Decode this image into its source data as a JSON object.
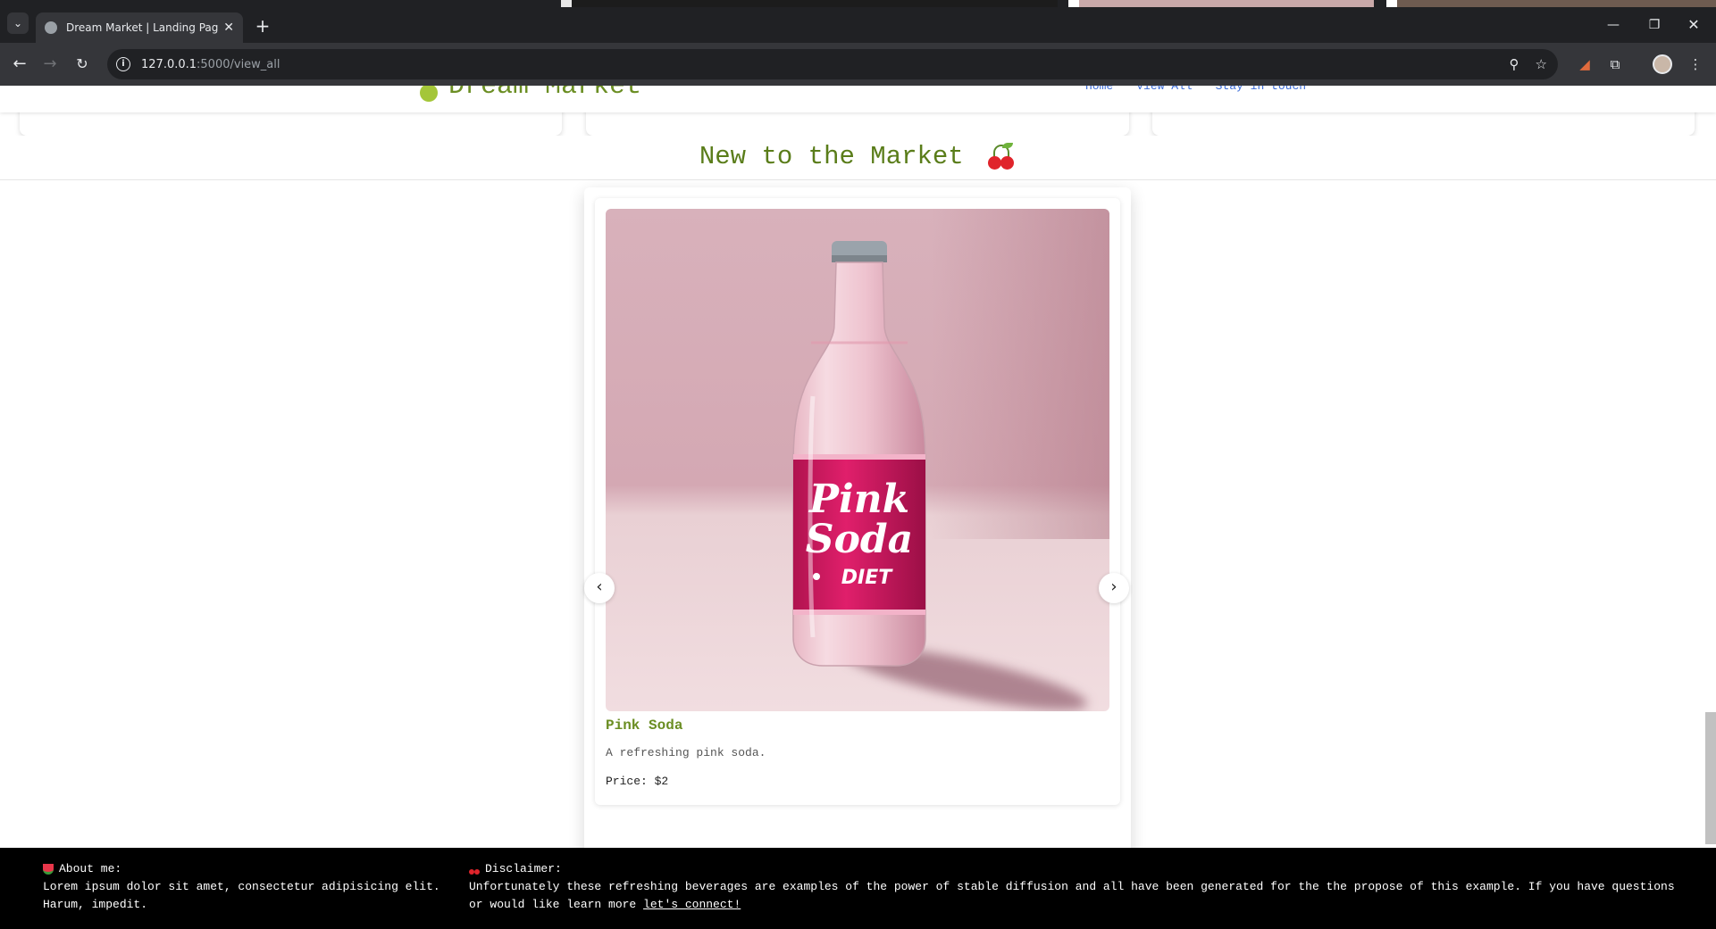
{
  "browser": {
    "tab_title": "Dream Market | Landing Page",
    "url_host": "127.0.0.1",
    "url_path": ":5000/view_all"
  },
  "header": {
    "brand": "Dream Market",
    "nav": [
      "Home",
      "View All",
      "Stay in touch"
    ]
  },
  "section": {
    "title": "New to the Market"
  },
  "carousel": {
    "product": {
      "name": "Pink Soda",
      "description": "A refreshing pink soda.",
      "price": "Price: $2",
      "label_line1": "Pink",
      "label_line2": "Soda",
      "label_line3": "DIET"
    }
  },
  "footer": {
    "about_heading": "About me:",
    "about_text": "Lorem ipsum dolor sit amet, consectetur adipisicing elit. Harum, impedit.",
    "disclaimer_heading": "Disclaimer:",
    "disclaimer_text": "Unfortunately these refreshing beverages are examples of the power of stable diffusion and all have been generated for the the propose of this example. If you have questions or would like learn more ",
    "disclaimer_link": "let's connect!"
  },
  "colors": {
    "accent_green": "#6b8e23",
    "link_blue": "#3b6cd9",
    "footer_bg": "#000000"
  }
}
